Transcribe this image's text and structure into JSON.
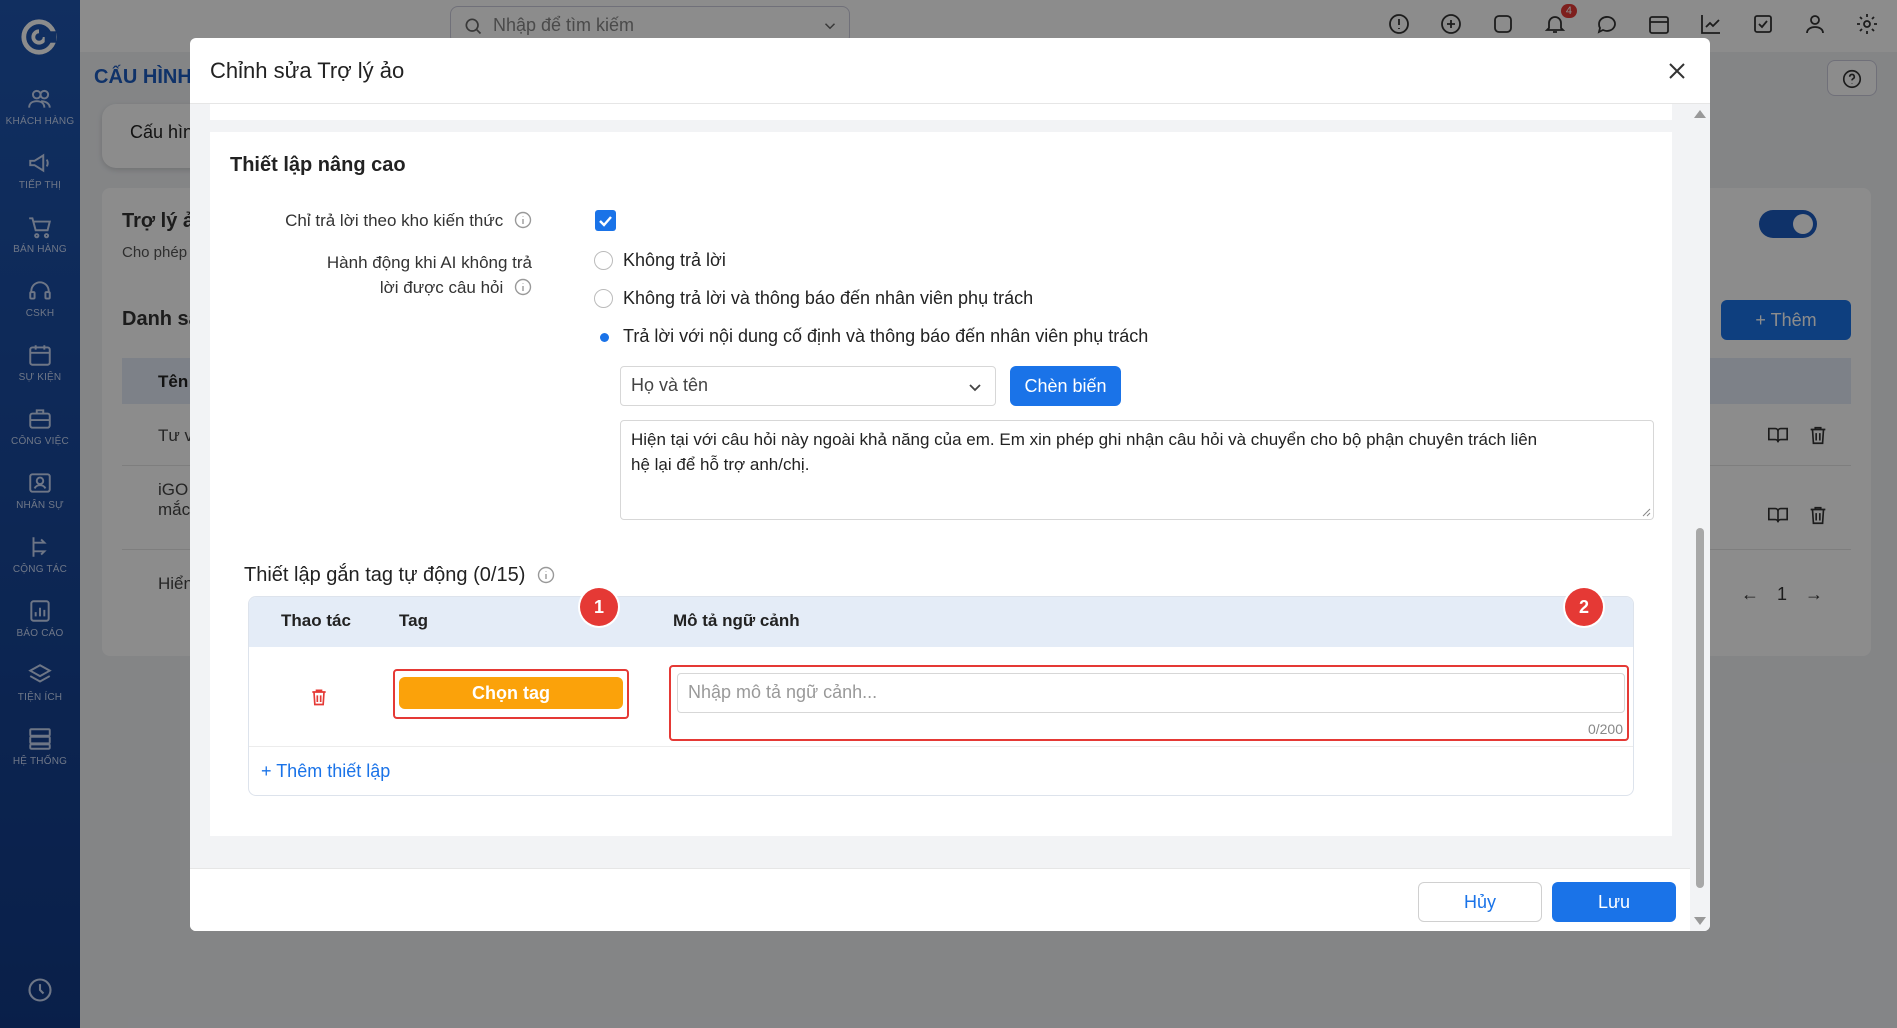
{
  "sidebar": {
    "items": [
      {
        "label": "KHÁCH HÀNG",
        "icon": "users-icon"
      },
      {
        "label": "TIẾP THỊ",
        "icon": "megaphone-icon"
      },
      {
        "label": "BÁN HÀNG",
        "icon": "cart-icon"
      },
      {
        "label": "CSKH",
        "icon": "headset-icon"
      },
      {
        "label": "SỰ KIỆN",
        "icon": "calendar-icon"
      },
      {
        "label": "CÔNG VIỆC",
        "icon": "briefcase-icon"
      },
      {
        "label": "NHÂN SỰ",
        "icon": "id-card-icon"
      },
      {
        "label": "CỘNG TÁC",
        "icon": "collab-icon"
      },
      {
        "label": "BÁO CÁO",
        "icon": "report-icon"
      },
      {
        "label": "TIỆN ÍCH",
        "icon": "layers-icon"
      },
      {
        "label": "HỆ THỐNG",
        "icon": "server-icon"
      }
    ]
  },
  "topbar": {
    "search_placeholder": "Nhập để tìm kiếm",
    "notification_count": "4"
  },
  "background": {
    "page_title": "CẤU HÌNH",
    "tab_label": "Cấu hìn",
    "panel_title": "Trợ lý ả",
    "panel_subtitle": "Cho phép",
    "list_title": "Danh sá",
    "table_header_name": "Tên",
    "row1": "Tư v",
    "row2_line1": "iGO",
    "row2_line2": "mắc",
    "row3": "Hiển t",
    "add_button": "Thêm",
    "page_number": "1"
  },
  "modal": {
    "title": "Chỉnh sửa Trợ lý ảo",
    "section_title": "Thiết lập nâng cao",
    "kb_only_label": "Chỉ trả lời theo kho kiến thức",
    "kb_only_checked": true,
    "fallback_label_line1": "Hành động khi AI không trả",
    "fallback_label_line2": "lời được câu hỏi",
    "options": [
      {
        "label": "Không trả lời",
        "selected": false
      },
      {
        "label": "Không trả lời và thông báo đến nhân viên phụ trách",
        "selected": false
      },
      {
        "label": "Trả lời với nội dung cố định và thông báo đến nhân viên phụ trách",
        "selected": true
      }
    ],
    "variable_select": "Họ và tên",
    "insert_variable_button": "Chèn biến",
    "fixed_reply_line1": "Hiện tại với câu hỏi này ngoài khả năng của em. Em xin phép ghi nhận câu hỏi và chuyển cho bộ phận chuyên trách liên",
    "fixed_reply_line2": "hệ lại để hỗ trợ anh/chị.",
    "tag_section_title": "Thiết lập gắn tag tự động (0/15)",
    "tag_table": {
      "col_action": "Thao tác",
      "col_tag": "Tag",
      "col_desc": "Mô tả ngữ cảnh",
      "choose_tag_button": "Chọn tag",
      "desc_placeholder": "Nhập mô tả ngữ cảnh...",
      "desc_count": "0/200",
      "add_row": "Thêm thiết lập"
    },
    "callouts": [
      "1",
      "2"
    ],
    "cancel_button": "Hủy",
    "save_button": "Lưu"
  },
  "colors": {
    "sidebar_top": "#1f56b0",
    "primary": "#1a73e8",
    "tag_button": "#fba20a",
    "highlight": "#e53935"
  }
}
